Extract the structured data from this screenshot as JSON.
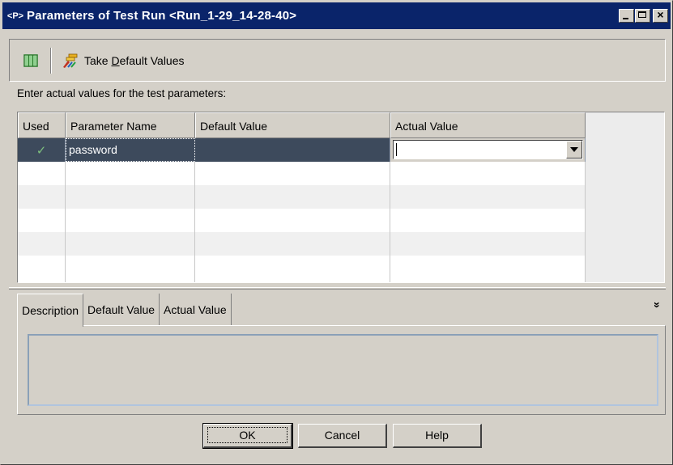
{
  "window": {
    "title": "Parameters of Test Run <Run_1-29_14-28-40>",
    "icon_text": "<P>"
  },
  "toolbar": {
    "take_default_label_prefix": "Take ",
    "take_default_label_accel": "D",
    "take_default_label_rest": "efault Values"
  },
  "instruction": "Enter actual values for the test parameters:",
  "grid": {
    "columns": [
      "Used",
      "Parameter Name",
      "Default Value",
      "Actual Value"
    ],
    "rows": [
      {
        "used": "✓",
        "name": "password",
        "default_value": "",
        "actual_value": ""
      }
    ]
  },
  "tabs": {
    "items": [
      "Description",
      "Default Value",
      "Actual Value"
    ],
    "active": "Description"
  },
  "buttons": {
    "ok": "OK",
    "cancel": "Cancel",
    "help": "Help"
  },
  "colors": {
    "title_bar": "#0a246a",
    "selected_row": "#3d4a5c",
    "check": "#7ec07e"
  }
}
